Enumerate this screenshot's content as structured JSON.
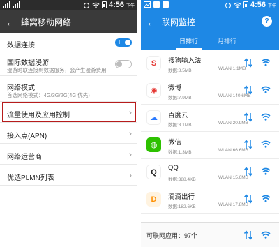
{
  "left": {
    "status": {
      "signal1": "4G",
      "time": "4:56",
      "ampm": "下午"
    },
    "title": "蜂窝移动网络",
    "rows": [
      {
        "label": "数据连接",
        "toggle": "on"
      },
      {
        "label": "国际数据漫游",
        "sub": "漫游时联连接到数据服务，会产生漫游费用",
        "toggle": "off"
      },
      {
        "label": "网络模式",
        "sub": "首选网络模式：4G/3G/2G(4G 优先)"
      },
      {
        "label": "流量使用及应用控制",
        "highlighted": true
      },
      {
        "label": "接入点(APN)"
      },
      {
        "label": "网络运营商"
      },
      {
        "label": "优选PLMN列表"
      }
    ]
  },
  "right": {
    "status": {
      "time": "4:56",
      "ampm": "下午"
    },
    "title": "联网监控",
    "help_label": "?",
    "tabs": [
      "日排行",
      "月排行"
    ],
    "active_tab": 0,
    "apps": [
      {
        "name": "搜狗输入法",
        "data": "数据:8.5MB",
        "wlan": "WLAN:1.1MB",
        "icon": "sogou-icon",
        "color": "#ffffff",
        "glyph": "S",
        "glyph_color": "#e53935"
      },
      {
        "name": "微博",
        "data": "数据:7.9MB",
        "wlan": "WLAN:140.6MB",
        "icon": "weibo-icon",
        "color": "#ffffff",
        "glyph": "◉",
        "glyph_color": "#e53935"
      },
      {
        "name": "百度云",
        "data": "数据:3.1MB",
        "wlan": "WLAN:20.9MB",
        "icon": "baidu-cloud-icon",
        "color": "#ffffff",
        "glyph": "☁",
        "glyph_color": "#2979ff"
      },
      {
        "name": "微信",
        "data": "数据:1.3MB",
        "wlan": "WLAN:66.6MB",
        "icon": "wechat-icon",
        "color": "#2dc100",
        "glyph": "◍",
        "glyph_color": "#ffffff"
      },
      {
        "name": "QQ",
        "data": "数据:388.4KB",
        "wlan": "WLAN:15.6MB",
        "icon": "qq-icon",
        "color": "#ffffff",
        "glyph": "Q",
        "glyph_color": "#222222"
      },
      {
        "name": "滴滴出行",
        "data": "数据:182.6KB",
        "wlan": "WLAN:17.8MB",
        "icon": "didi-icon",
        "color": "#fff3e0",
        "glyph": "D",
        "glyph_color": "#ff8f00"
      }
    ],
    "footer": "可联网应用：97个"
  },
  "colors": {
    "blue": "#1e88e5",
    "highlight": "#b71c1c"
  }
}
